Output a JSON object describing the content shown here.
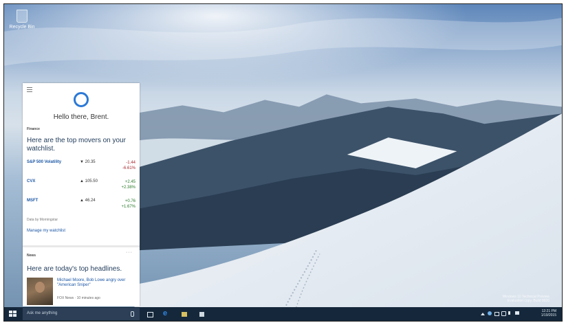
{
  "desktop": {
    "recycle_bin_label": "Recycle Bin"
  },
  "cortana": {
    "greeting": "Hello there, Brent.",
    "finance_card": {
      "kicker": "Finance",
      "title": "Here are the top movers on your watchlist.",
      "stocks": [
        {
          "symbol": "S&P 500 Volatility",
          "price": "▼ 20.35",
          "change": "-1.44",
          "percent": "-6.61%",
          "direction": "down"
        },
        {
          "symbol": "CVX",
          "price": "▲ 105.50",
          "change": "+2.45",
          "percent": "+2.38%",
          "direction": "up"
        },
        {
          "symbol": "MSFT",
          "price": "▲ 46.24",
          "change": "+0.76",
          "percent": "+1.67%",
          "direction": "up"
        }
      ],
      "attribution": "Data by Morningstar",
      "manage_link": "Manage my watchlist"
    },
    "news_card": {
      "kicker": "News",
      "more": "···",
      "title": "Here are today's top headlines.",
      "headline": "Michael Moore, Bob Lowe angry over \"American Sniper\"",
      "meta": "FOX News · 10 minutes ago"
    }
  },
  "watermark": {
    "line1": "Windows 10 Technical Preview",
    "line2": "Evaluation copy. Build 9926"
  },
  "taskbar": {
    "search_placeholder": "Ask me anything",
    "clock_time": "12:21 PM",
    "clock_date": "1/19/2015"
  },
  "colors": {
    "taskbar": "#15283b",
    "cortana_accent": "#2b79d6",
    "link_blue": "#1c57a5"
  }
}
